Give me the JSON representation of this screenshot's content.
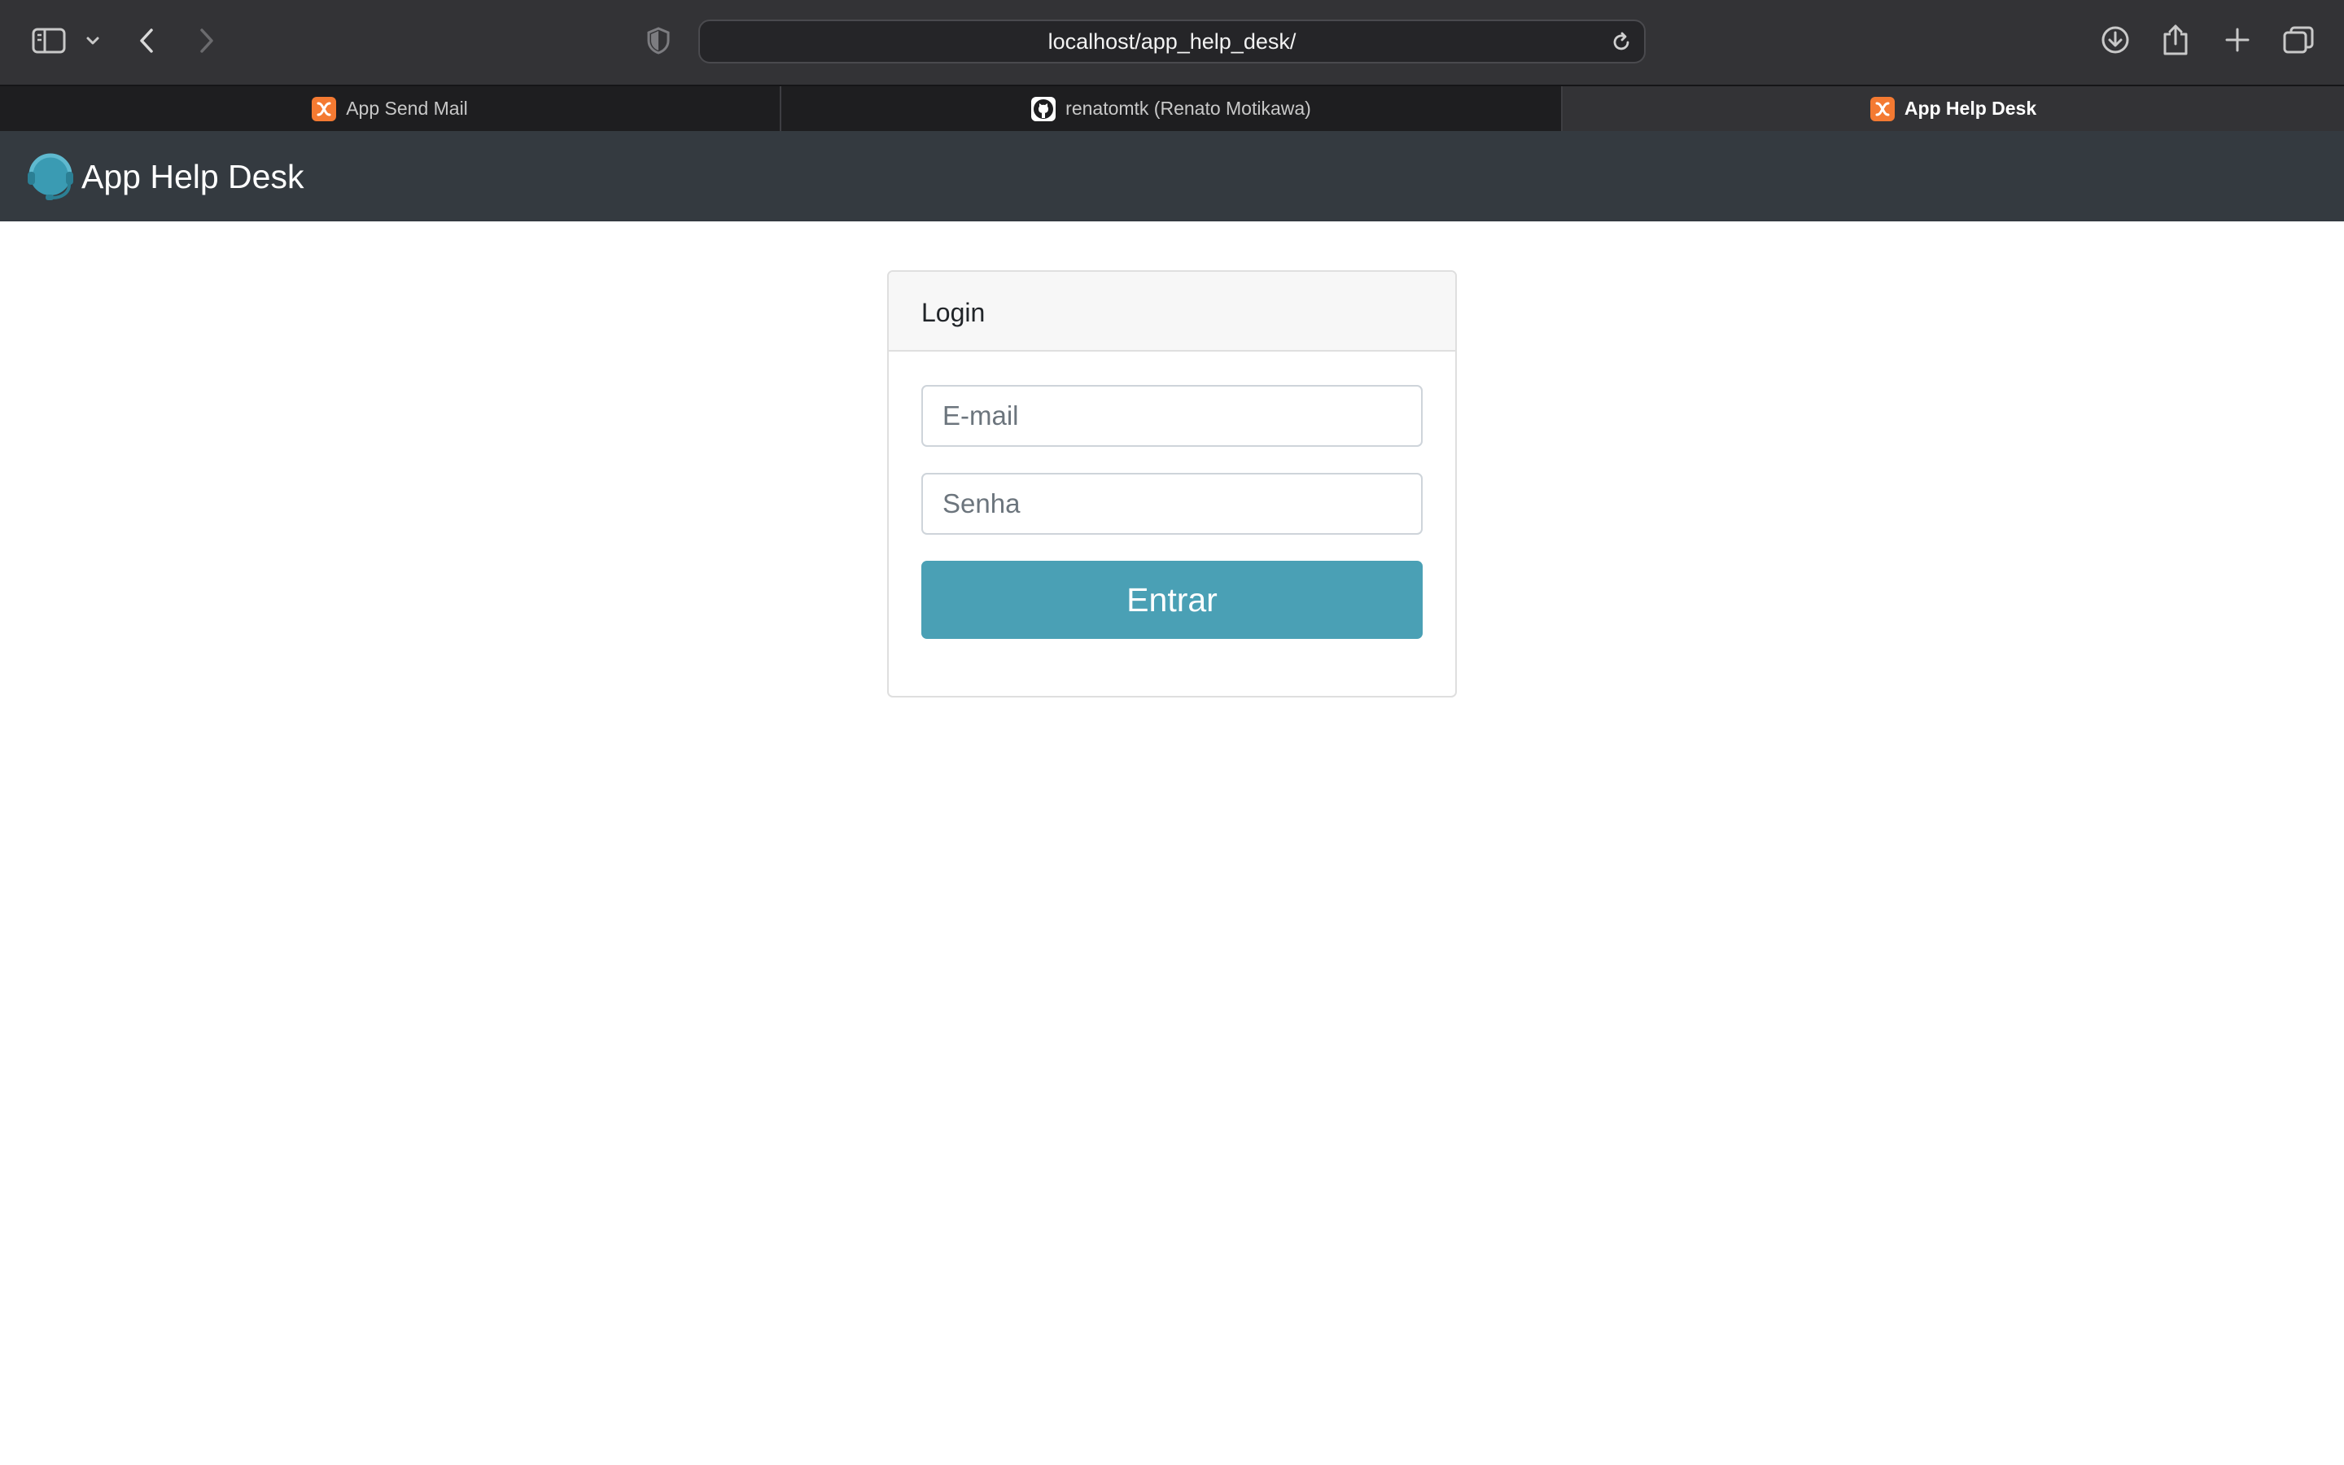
{
  "browser": {
    "url": "localhost/app_help_desk/",
    "tabs": [
      {
        "title": "App Send Mail",
        "favicon": "xampp-icon",
        "active": false
      },
      {
        "title": "renatomtk (Renato Motikawa)",
        "favicon": "github-icon",
        "active": false
      },
      {
        "title": "App Help Desk",
        "favicon": "xampp-icon",
        "active": true
      }
    ],
    "toolbar_icons": [
      "sidebar-icon",
      "chevron-down-icon",
      "back-icon",
      "forward-icon",
      "shield-icon",
      "reload-icon",
      "download-icon",
      "share-icon",
      "new-tab-icon",
      "tab-overview-icon"
    ]
  },
  "navbar": {
    "brand": "App Help Desk",
    "logo_icon": "headset-icon",
    "background": "#343a40"
  },
  "login": {
    "title": "Login",
    "email_placeholder": "E-mail",
    "password_placeholder": "Senha",
    "submit_label": "Entrar",
    "accent": "#4aa0b5"
  }
}
